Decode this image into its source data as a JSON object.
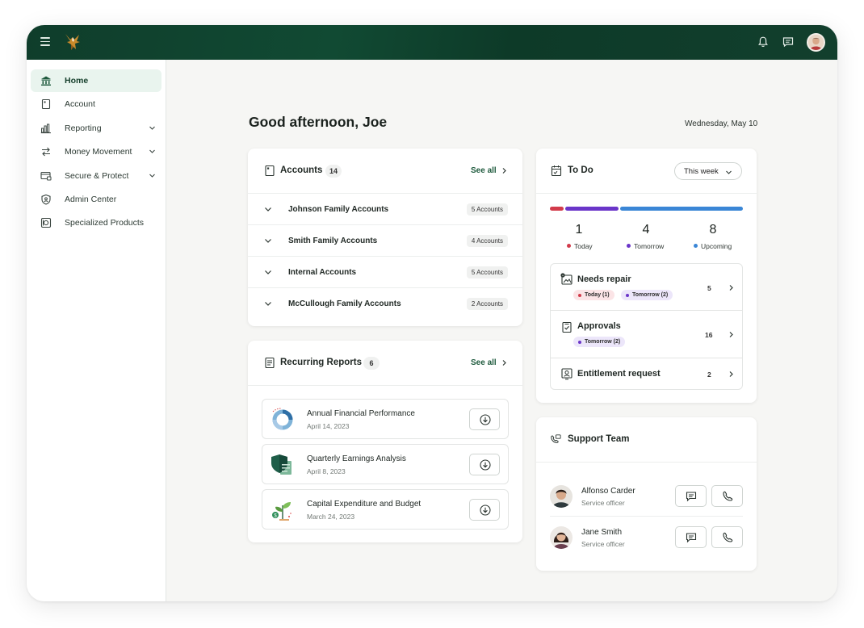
{
  "topbar": {
    "menu_icon": "hamburger-icon",
    "logo": "eagle-logo",
    "bell_icon": "bell-icon",
    "chat_icon": "message-icon",
    "avatar": "user-avatar"
  },
  "sidebar": {
    "items": [
      {
        "label": "Home",
        "icon": "bank-icon",
        "active": true,
        "expandable": false
      },
      {
        "label": "Account",
        "icon": "account-icon",
        "active": false,
        "expandable": false
      },
      {
        "label": "Reporting",
        "icon": "bar-chart-icon",
        "active": false,
        "expandable": true
      },
      {
        "label": "Money Movement",
        "icon": "transfer-icon",
        "active": false,
        "expandable": true
      },
      {
        "label": "Secure & Protect",
        "icon": "card-lock-icon",
        "active": false,
        "expandable": true
      },
      {
        "label": "Admin Center",
        "icon": "shield-icon",
        "active": false,
        "expandable": false
      },
      {
        "label": "Specialized Products",
        "icon": "vault-icon",
        "active": false,
        "expandable": false
      }
    ]
  },
  "header": {
    "greeting": "Good afternoon, Joe",
    "date": "Wednesday, May 10"
  },
  "accounts": {
    "title": "Accounts",
    "count": "14",
    "see_all": "See all",
    "rows": [
      {
        "name": "Johnson Family Accounts",
        "badge": "5 Accounts"
      },
      {
        "name": "Smith Family Accounts",
        "badge": "4 Accounts"
      },
      {
        "name": "Internal Accounts",
        "badge": "5 Accounts"
      },
      {
        "name": "McCullough Family Accounts",
        "badge": "2 Accounts"
      }
    ]
  },
  "reports": {
    "title": "Recurring  Reports",
    "count": "6",
    "see_all": "See all",
    "items": [
      {
        "title": "Annual Financial Performance",
        "date": "April 14, 2023",
        "thumb": "pie-chart-thumbnail"
      },
      {
        "title": "Quarterly Earnings Analysis",
        "date": "April 8, 2023",
        "thumb": "shield-document-thumbnail"
      },
      {
        "title": "Capital Expenditure and Budget",
        "date": "March 24, 2023",
        "thumb": "plant-growth-thumbnail"
      }
    ]
  },
  "todo": {
    "title": "To Do",
    "range": "This week",
    "stats": [
      {
        "value": "1",
        "label": "Today",
        "color": "#d23b4b"
      },
      {
        "value": "4",
        "label": "Tomorrow",
        "color": "#6a35c9"
      },
      {
        "value": "8",
        "label": "Upcoming",
        "color": "#3a86d6"
      }
    ],
    "items": [
      {
        "title": "Needs repair",
        "count": "5",
        "tags": [
          {
            "label": "Today (1)",
            "bg": "#fbe4e6",
            "dot": "#d23b4b"
          },
          {
            "label": "Tomorrow (2)",
            "bg": "#ece6fa",
            "dot": "#6a35c9"
          }
        ]
      },
      {
        "title": "Approvals",
        "count": "16",
        "tags": [
          {
            "label": "Tomorrow (2)",
            "bg": "#ece6fa",
            "dot": "#6a35c9"
          }
        ]
      },
      {
        "title": "Entitlement request",
        "count": "2",
        "tags": []
      }
    ]
  },
  "support": {
    "title": "Support Team",
    "members": [
      {
        "name": "Alfonso Carder",
        "role": "Service officer"
      },
      {
        "name": "Jane Smith",
        "role": "Service officer"
      }
    ]
  },
  "colors": {
    "brand_dark": "#0f3d2b",
    "accent": "#1e5a3d",
    "active_bg": "#e9f4ee"
  }
}
